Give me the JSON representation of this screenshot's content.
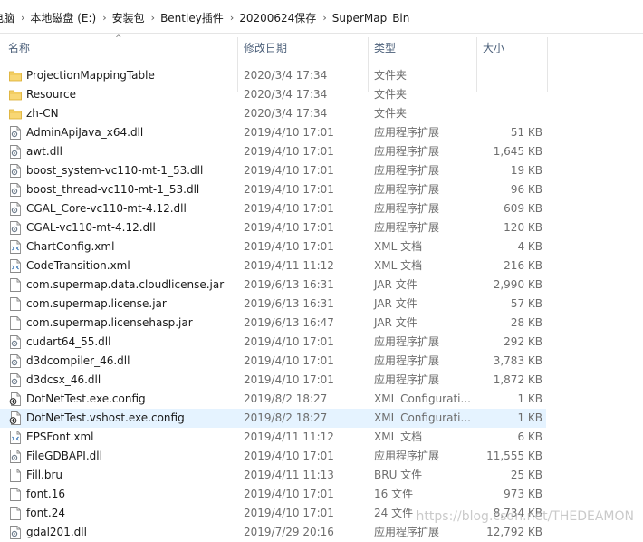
{
  "breadcrumb": [
    "电脑",
    "本地磁盘 (E:)",
    "安装包",
    "Bentley插件",
    "20200624保存",
    "SuperMap_Bin"
  ],
  "columns": {
    "name": "名称",
    "date": "修改日期",
    "type": "类型",
    "size": "大小"
  },
  "rows": [
    {
      "name": "ProjectionMappingTable",
      "date": "2020/3/4 17:34",
      "type": "文件夹",
      "size": "",
      "icon": "folder"
    },
    {
      "name": "Resource",
      "date": "2020/3/4 17:34",
      "type": "文件夹",
      "size": "",
      "icon": "folder"
    },
    {
      "name": "zh-CN",
      "date": "2020/3/4 17:34",
      "type": "文件夹",
      "size": "",
      "icon": "folder"
    },
    {
      "name": "AdminApiJava_x64.dll",
      "date": "2019/4/10 17:01",
      "type": "应用程序扩展",
      "size": "51 KB",
      "icon": "dll"
    },
    {
      "name": "awt.dll",
      "date": "2019/4/10 17:01",
      "type": "应用程序扩展",
      "size": "1,645 KB",
      "icon": "dll"
    },
    {
      "name": "boost_system-vc110-mt-1_53.dll",
      "date": "2019/4/10 17:01",
      "type": "应用程序扩展",
      "size": "19 KB",
      "icon": "dll"
    },
    {
      "name": "boost_thread-vc110-mt-1_53.dll",
      "date": "2019/4/10 17:01",
      "type": "应用程序扩展",
      "size": "96 KB",
      "icon": "dll"
    },
    {
      "name": "CGAL_Core-vc110-mt-4.12.dll",
      "date": "2019/4/10 17:01",
      "type": "应用程序扩展",
      "size": "609 KB",
      "icon": "dll"
    },
    {
      "name": "CGAL-vc110-mt-4.12.dll",
      "date": "2019/4/10 17:01",
      "type": "应用程序扩展",
      "size": "120 KB",
      "icon": "dll"
    },
    {
      "name": "ChartConfig.xml",
      "date": "2019/4/10 17:01",
      "type": "XML 文档",
      "size": "4 KB",
      "icon": "xml"
    },
    {
      "name": "CodeTransition.xml",
      "date": "2019/4/11 11:12",
      "type": "XML 文档",
      "size": "216 KB",
      "icon": "xml"
    },
    {
      "name": "com.supermap.data.cloudlicense.jar",
      "date": "2019/6/13 16:31",
      "type": "JAR 文件",
      "size": "2,990 KB",
      "icon": "file"
    },
    {
      "name": "com.supermap.license.jar",
      "date": "2019/6/13 16:31",
      "type": "JAR 文件",
      "size": "57 KB",
      "icon": "file"
    },
    {
      "name": "com.supermap.licensehasp.jar",
      "date": "2019/6/13 16:47",
      "type": "JAR 文件",
      "size": "28 KB",
      "icon": "file"
    },
    {
      "name": "cudart64_55.dll",
      "date": "2019/4/10 17:01",
      "type": "应用程序扩展",
      "size": "292 KB",
      "icon": "dll"
    },
    {
      "name": "d3dcompiler_46.dll",
      "date": "2019/4/10 17:01",
      "type": "应用程序扩展",
      "size": "3,783 KB",
      "icon": "dll"
    },
    {
      "name": "d3dcsx_46.dll",
      "date": "2019/4/10 17:01",
      "type": "应用程序扩展",
      "size": "1,872 KB",
      "icon": "dll"
    },
    {
      "name": "DotNetTest.exe.config",
      "date": "2019/8/2 18:27",
      "type": "XML Configurati...",
      "size": "1 KB",
      "icon": "config"
    },
    {
      "name": "DotNetTest.vshost.exe.config",
      "date": "2019/8/2 18:27",
      "type": "XML Configurati...",
      "size": "1 KB",
      "icon": "config",
      "hover": true
    },
    {
      "name": "EPSFont.xml",
      "date": "2019/4/11 11:12",
      "type": "XML 文档",
      "size": "6 KB",
      "icon": "xml"
    },
    {
      "name": "FileGDBAPI.dll",
      "date": "2019/4/10 17:01",
      "type": "应用程序扩展",
      "size": "11,555 KB",
      "icon": "dll"
    },
    {
      "name": "Fill.bru",
      "date": "2019/4/11 11:13",
      "type": "BRU 文件",
      "size": "25 KB",
      "icon": "file"
    },
    {
      "name": "font.16",
      "date": "2019/4/10 17:01",
      "type": "16 文件",
      "size": "973 KB",
      "icon": "file"
    },
    {
      "name": "font.24",
      "date": "2019/4/10 17:01",
      "type": "24 文件",
      "size": "8,734 KB",
      "icon": "file"
    },
    {
      "name": "gdal201.dll",
      "date": "2019/7/29 20:16",
      "type": "应用程序扩展",
      "size": "12,792 KB",
      "icon": "dll"
    }
  ],
  "watermark": "https://blog.csdn.net/THEDEAMON"
}
